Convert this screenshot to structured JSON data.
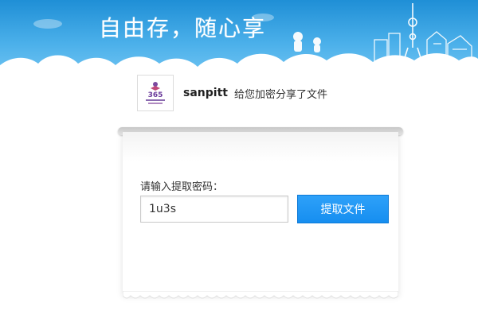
{
  "banner": {
    "slogan": "自由存，随心享"
  },
  "sharer": {
    "avatar_icon": "sharer-avatar-logo",
    "username": "sanpitt",
    "message": "给您加密分享了文件"
  },
  "form": {
    "prompt": "请输入提取密码：",
    "code_value": "1u3s",
    "submit_label": "提取文件"
  },
  "colors": {
    "sky_top": "#1f8fd6",
    "sky_bottom": "#74c6f3",
    "button": "#168ef0"
  }
}
